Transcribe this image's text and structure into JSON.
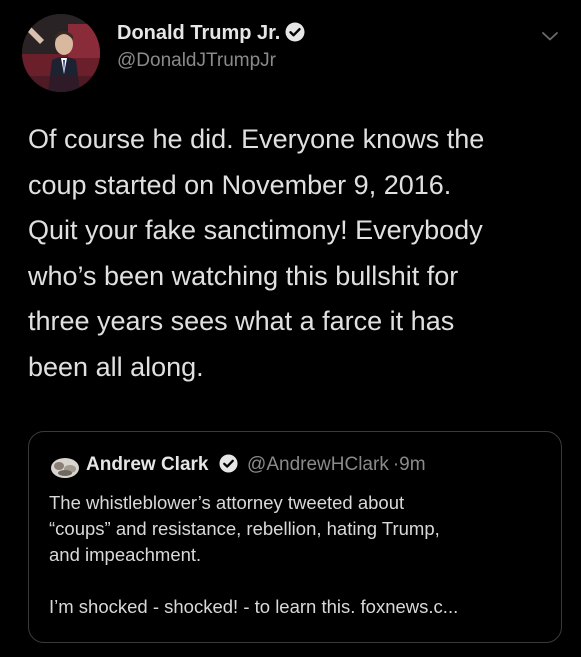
{
  "tweet": {
    "author_name": "Donald Trump Jr.",
    "author_handle": "@DonaldJTrumpJr",
    "text_lines": [
      "Of course he did. Everyone knows the",
      "coup started on November 9, 2016.",
      "Quit your fake sanctimony! Everybody",
      "who’s been watching this bullshit for",
      "three years sees what a farce it has",
      "been all along."
    ],
    "menu_icon": "chevron-down-icon"
  },
  "quote": {
    "author_name": "Andrew Clark",
    "author_handle": "@AndrewHClark",
    "separator": "·",
    "time": "9m",
    "text_lines": [
      "The whistleblower’s attorney tweeted about",
      "“coups” and resistance, rebellion, hating Trump,",
      "and impeachment."
    ],
    "text_lines_2": [
      "I’m shocked - shocked! - to learn this. foxnews.c..."
    ]
  },
  "colors": {
    "background": "#000000",
    "text": "#e0e0e0",
    "secondary": "#8a8a8a",
    "border": "#3a3a3a",
    "verified_badge": "#e6e6e6"
  }
}
